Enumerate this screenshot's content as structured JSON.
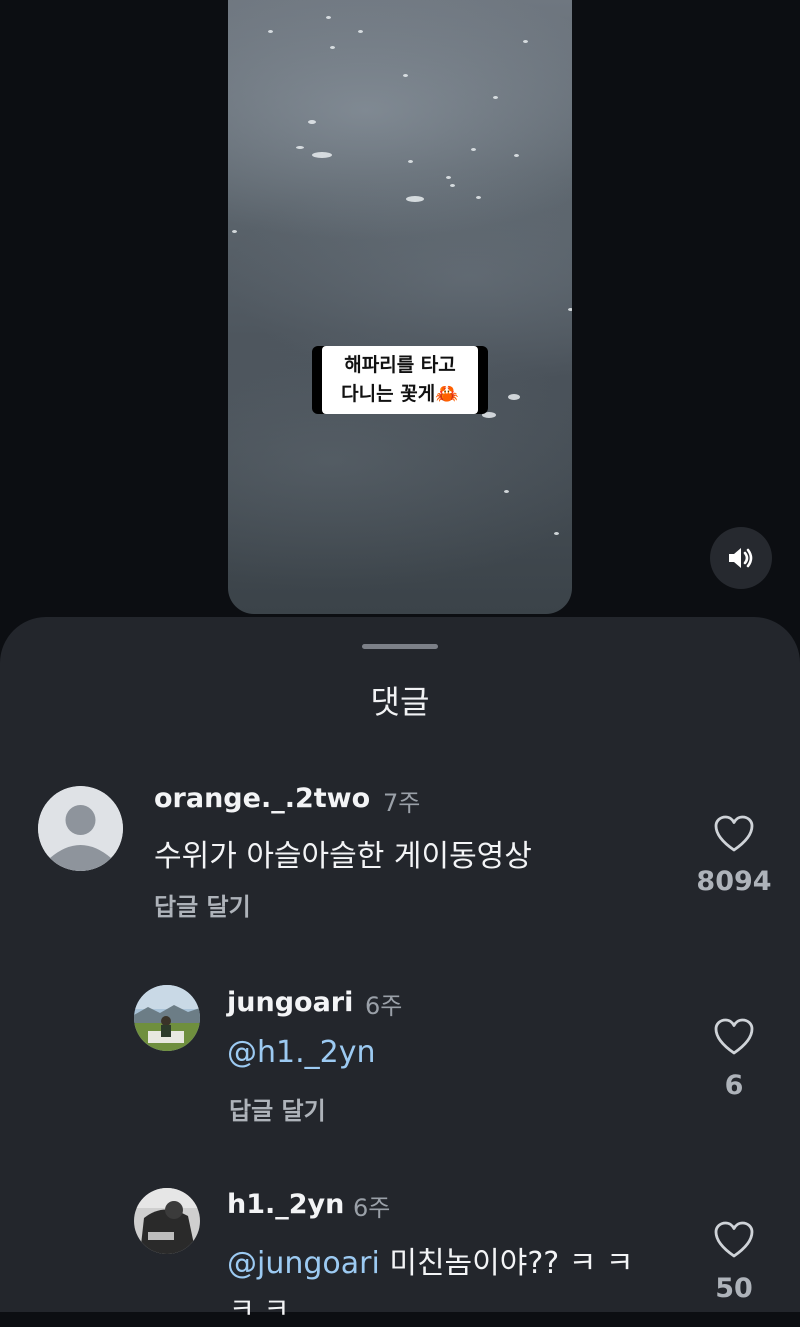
{
  "video": {
    "caption_line1": "해파리를 타고",
    "caption_line2": "다니는 꽃게🦀",
    "sound_icon": "speaker-on-icon"
  },
  "sheet": {
    "title": "댓글"
  },
  "comments": [
    {
      "username": "orange._.2two",
      "time": "7주",
      "text": "수위가 아슬아슬한 게이동영상",
      "reply_label": "답글 달기",
      "likes": "8094",
      "avatar": "default-avatar-icon"
    },
    {
      "username": "jungoari",
      "time": "6주",
      "mention": "@h1._2yn",
      "text": "",
      "reply_label": "답글 달기",
      "likes": "6",
      "avatar": "landscape-photo-avatar"
    },
    {
      "username": "h1._2yn",
      "time": "6주",
      "mention": "@jungoari",
      "text": " 미친놈이야?? ㅋ ㅋ",
      "text_cont": "ㅋ ㅋ",
      "likes": "50",
      "avatar": "dark-photo-avatar"
    }
  ],
  "colors": {
    "background": "#0c0e12",
    "sheet": "#23262c",
    "mention": "#9ccaf2"
  }
}
